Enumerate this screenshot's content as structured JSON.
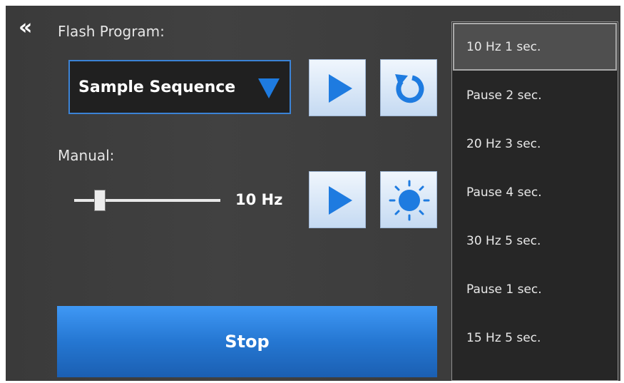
{
  "flash_program": {
    "label": "Flash Program:",
    "selected_sequence": "Sample Sequence"
  },
  "manual": {
    "label": "Manual:",
    "frequency_readout": "10 Hz",
    "slider_value_fraction": 0.15
  },
  "stop": {
    "label": "Stop"
  },
  "sequence_steps": [
    {
      "label": "10 Hz 1 sec.",
      "selected": true
    },
    {
      "label": "Pause 2 sec.",
      "selected": false
    },
    {
      "label": "20 Hz 3 sec.",
      "selected": false
    },
    {
      "label": "Pause 4 sec.",
      "selected": false
    },
    {
      "label": "30 Hz 5 sec.",
      "selected": false
    },
    {
      "label": "Pause 1 sec.",
      "selected": false
    },
    {
      "label": "15 Hz 5 sec.",
      "selected": false
    }
  ],
  "icons": {
    "collapse": "double-chevron-left-icon",
    "caret": "triangle-down-icon",
    "play": "play-icon",
    "reset": "refresh-icon",
    "light": "sun-icon"
  },
  "colors": {
    "accent": "#1e7be0",
    "panel_bg": "#3b3b3b",
    "dropdown_bg": "#262626",
    "stop_button": "#2577d2"
  }
}
